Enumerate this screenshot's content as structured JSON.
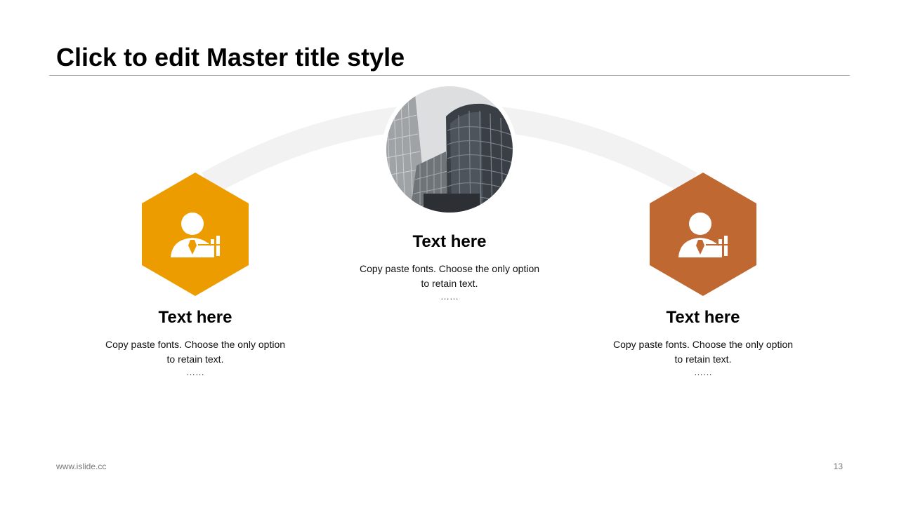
{
  "slide": {
    "title": "Click to edit Master title style",
    "footer_url": "www.islide.cc",
    "page_number": "13"
  },
  "colors": {
    "left_accent": "#ED9C00",
    "right_accent": "#C06832",
    "arc": "#F2F2F2",
    "rule": "#A6A6A6"
  },
  "items": [
    {
      "heading": "Text here",
      "line1": "Copy paste fonts. Choose the only option",
      "line2": "to retain text.",
      "ellipsis": "……",
      "icon": "businessman-chart-icon"
    },
    {
      "heading": "Text here",
      "line1": "Copy paste fonts. Choose the only option",
      "line2": "to retain text.",
      "ellipsis": "……",
      "image": "skyscrapers-photo"
    },
    {
      "heading": "Text here",
      "line1": "Copy paste fonts. Choose the only option",
      "line2": "to retain text.",
      "ellipsis": "……",
      "icon": "businessman-chart-icon"
    }
  ]
}
